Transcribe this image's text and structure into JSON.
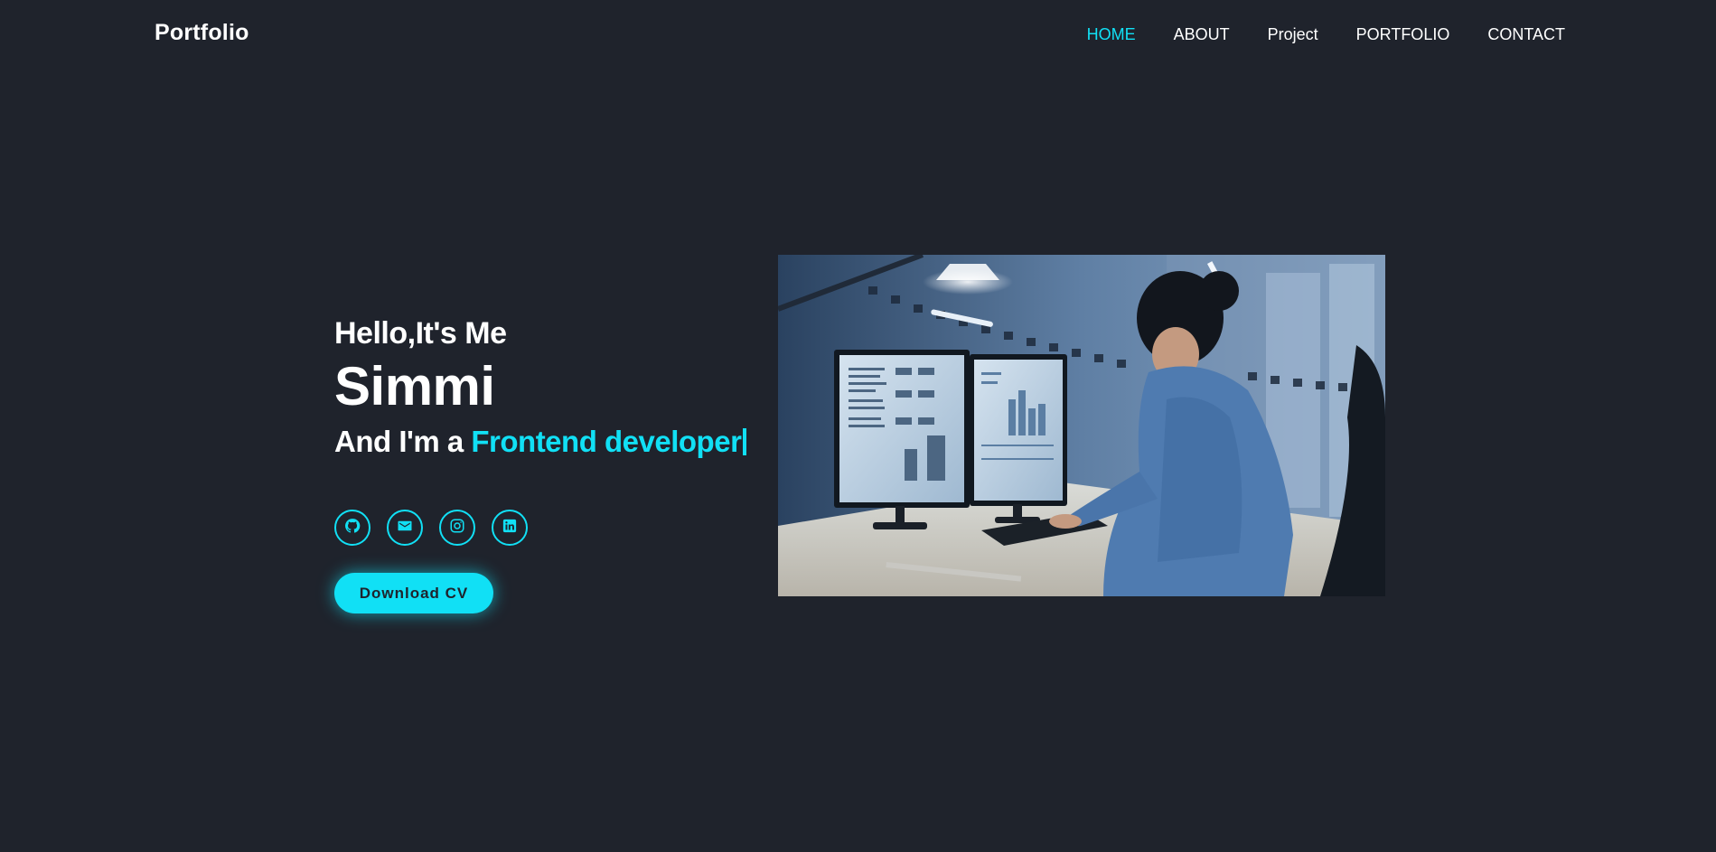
{
  "header": {
    "logo": "Portfolio",
    "nav": [
      {
        "label": "HOME",
        "active": true
      },
      {
        "label": "ABOUT",
        "active": false
      },
      {
        "label": "Project",
        "active": false
      },
      {
        "label": "PORTFOLIO",
        "active": false
      },
      {
        "label": "CONTACT",
        "active": false
      }
    ]
  },
  "hero": {
    "greeting": "Hello,It's Me",
    "name": "Simmi",
    "role_prefix": "And I'm a ",
    "role_highlight": "Frontend developer",
    "social_icons": [
      "github-icon",
      "mail-icon",
      "instagram-icon",
      "linkedin-icon"
    ],
    "cta_label": "Download CV",
    "image_subject": "woman-working-at-computer"
  },
  "colors": {
    "background": "#1f232c",
    "accent": "#11e0f5",
    "text": "#ffffff"
  }
}
